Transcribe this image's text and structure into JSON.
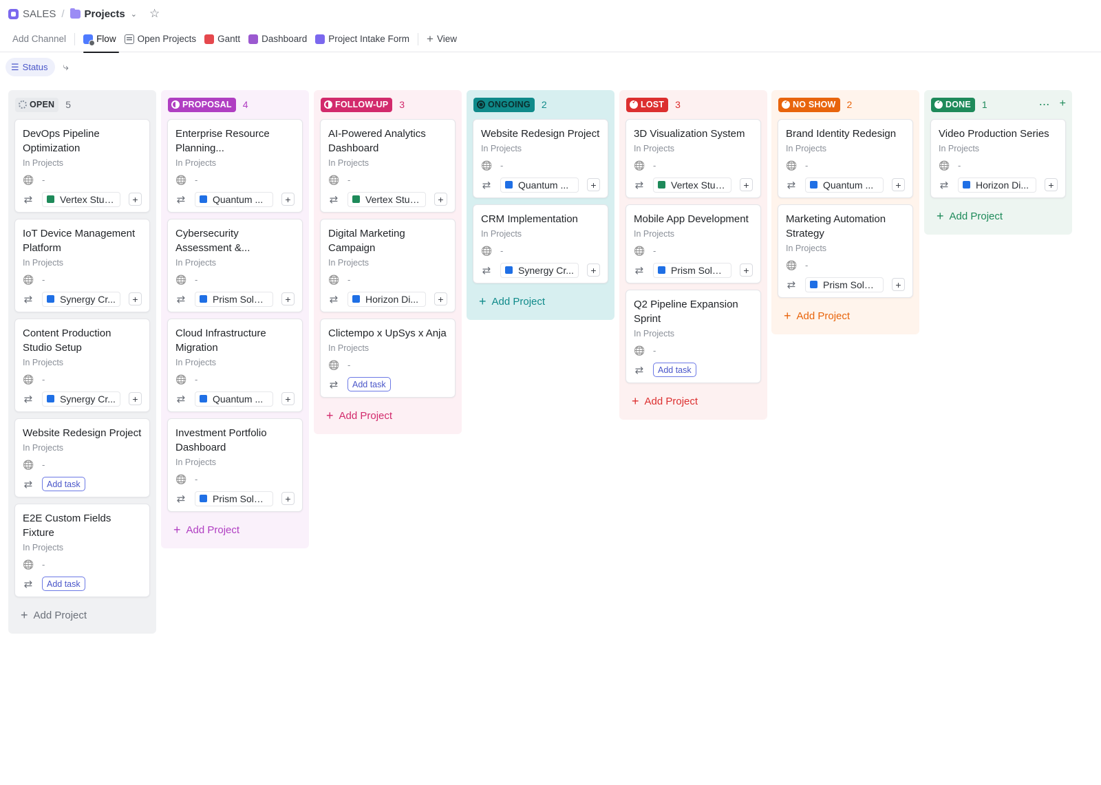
{
  "breadcrumb": {
    "space": "SALES",
    "separator": "/",
    "project": "Projects"
  },
  "tabs": [
    {
      "label": "Add Channel",
      "icon": "none"
    },
    {
      "label": "Flow",
      "icon": "flow-icon"
    },
    {
      "label": "Open Projects",
      "icon": "list-icon"
    },
    {
      "label": "Gantt",
      "icon": "gantt-icon"
    },
    {
      "label": "Dashboard",
      "icon": "dashboard-icon"
    },
    {
      "label": "Project Intake Form",
      "icon": "form-icon"
    },
    {
      "label": "View",
      "icon": "plus-icon"
    }
  ],
  "filters": {
    "status_label": "Status"
  },
  "colors": {
    "open": "#87909e",
    "proposal": "#b03ec2",
    "followup": "#d22a6c",
    "ongoing": "#0f8a8a",
    "lost": "#dc2f2f",
    "noshow": "#e8640c",
    "done": "#1e8a5a",
    "client_green": "#1e8a5a",
    "client_blue": "#1f6fe5"
  },
  "common": {
    "in_projects": "In Projects",
    "dash": "-",
    "add_task": "Add task",
    "add_project": "Add Project"
  },
  "columns": [
    {
      "label": "OPEN",
      "count": "5",
      "cards": [
        {
          "title": "DevOps Pipeline Optimization",
          "client": "Vertex Stud...",
          "client_color": "green"
        },
        {
          "title": "IoT Device Management Platform",
          "client": "Synergy Cr...",
          "client_color": "blue"
        },
        {
          "title": "Content Production Studio Setup",
          "client": "Synergy Cr...",
          "client_color": "blue"
        },
        {
          "title": "Website Redesign Project",
          "client": null
        },
        {
          "title": "E2E Custom Fields Fixture",
          "client": null
        }
      ]
    },
    {
      "label": "PROPOSAL",
      "count": "4",
      "cards": [
        {
          "title": "Enterprise Resource Planning...",
          "client": "Quantum ...",
          "client_color": "blue"
        },
        {
          "title": "Cybersecurity Assessment &...",
          "client": "Prism Solut...",
          "client_color": "blue"
        },
        {
          "title": "Cloud Infrastructure Migration",
          "client": "Quantum ...",
          "client_color": "blue"
        },
        {
          "title": "Investment Portfolio Dashboard",
          "client": "Prism Solut...",
          "client_color": "blue"
        }
      ]
    },
    {
      "label": "FOLLOW-UP",
      "count": "3",
      "cards": [
        {
          "title": "AI-Powered Analytics Dashboard",
          "client": "Vertex Stud...",
          "client_color": "green"
        },
        {
          "title": "Digital Marketing Campaign",
          "client": "Horizon Di...",
          "client_color": "blue"
        },
        {
          "title": "Clictempo x UpSys x Anja",
          "client": null
        }
      ]
    },
    {
      "label": "ONGOING",
      "count": "2",
      "cards": [
        {
          "title": "Website Redesign Project",
          "client": "Quantum ...",
          "client_color": "blue"
        },
        {
          "title": "CRM Implementation",
          "client": "Synergy Cr...",
          "client_color": "blue"
        }
      ]
    },
    {
      "label": "LOST",
      "count": "3",
      "cards": [
        {
          "title": "3D Visualization System",
          "client": "Vertex Stud...",
          "client_color": "green"
        },
        {
          "title": "Mobile App Development",
          "client": "Prism Solut...",
          "client_color": "blue"
        },
        {
          "title": "Q2 Pipeline Expansion Sprint",
          "client": null
        }
      ]
    },
    {
      "label": "NO SHOW",
      "count": "2",
      "cards": [
        {
          "title": "Brand Identity Redesign",
          "client": "Quantum ...",
          "client_color": "blue"
        },
        {
          "title": "Marketing Automation Strategy",
          "client": "Prism Solut...",
          "client_color": "blue"
        }
      ]
    },
    {
      "label": "DONE",
      "count": "1",
      "cards": [
        {
          "title": "Video Production Series",
          "client": "Horizon Di...",
          "client_color": "blue"
        }
      ]
    }
  ]
}
